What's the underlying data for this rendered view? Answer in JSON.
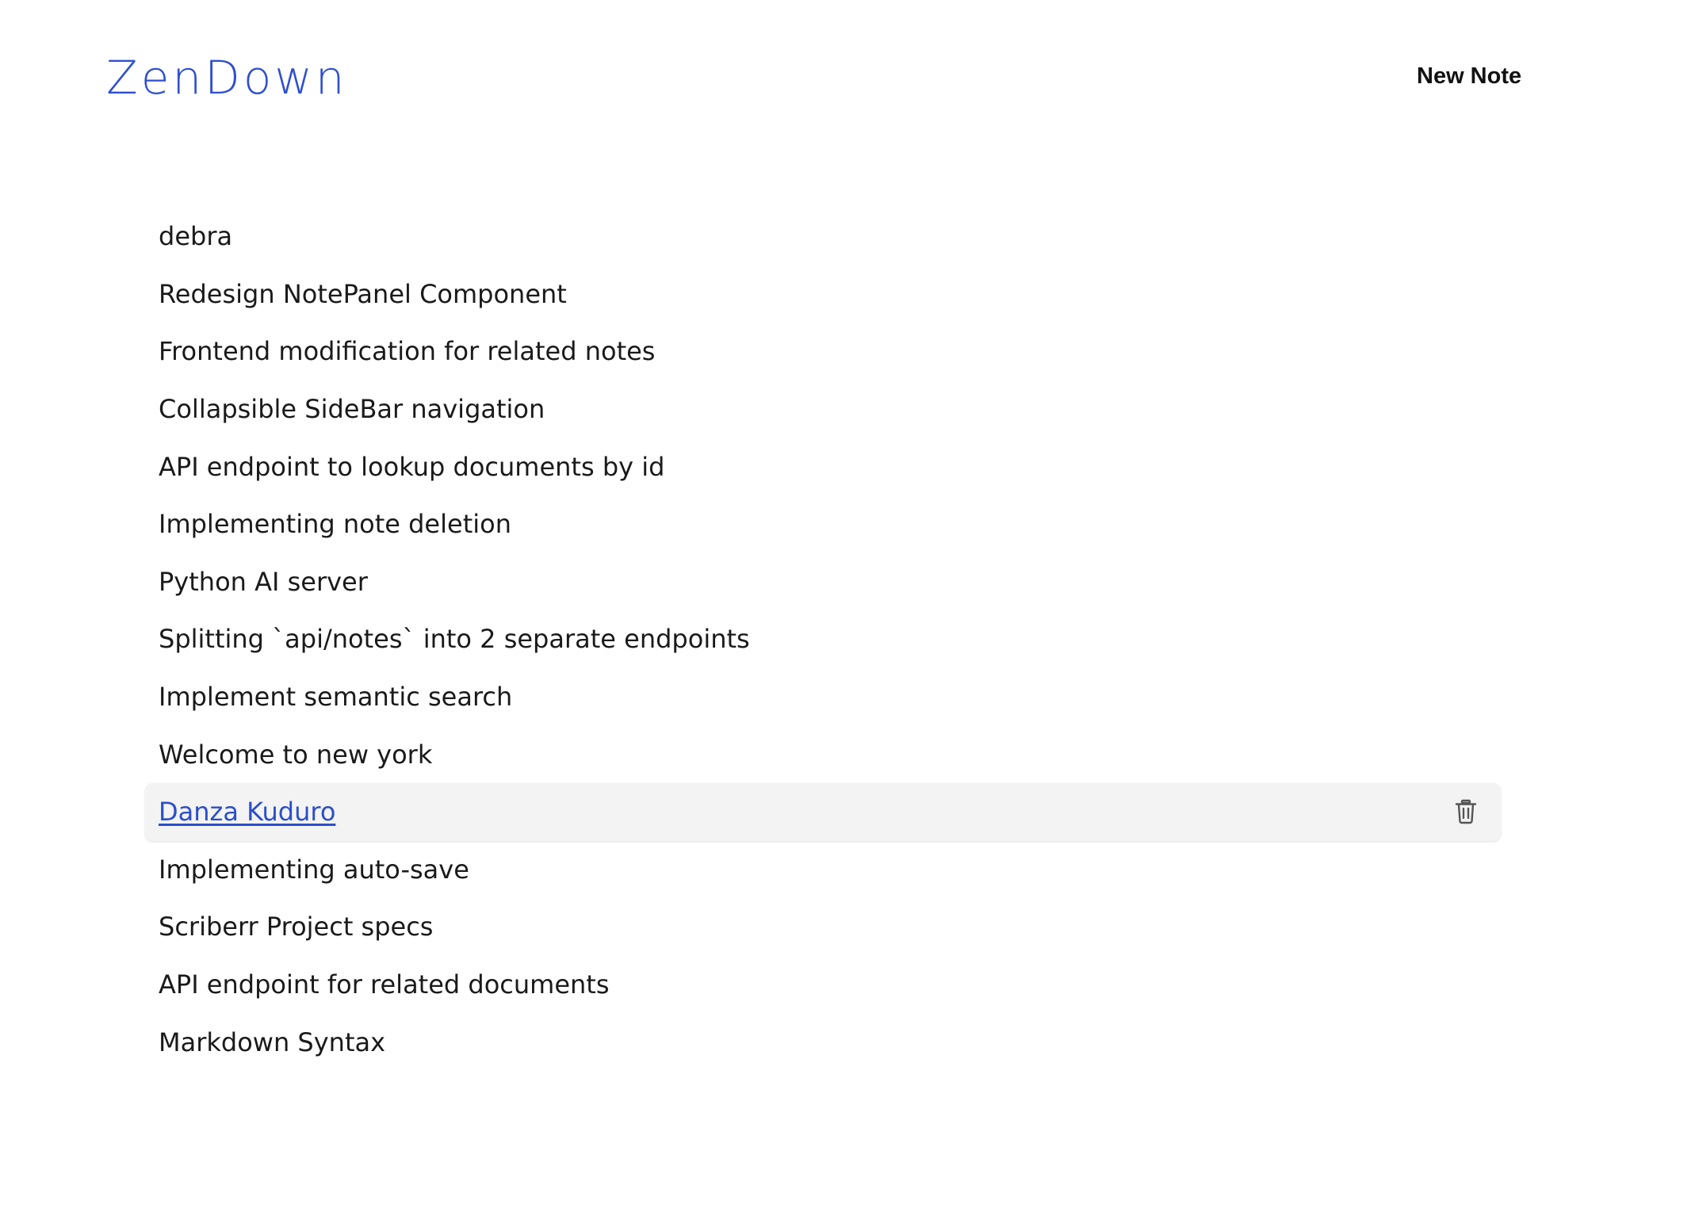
{
  "app": {
    "logo_text": "ZenDown",
    "brand_color": "#2f4fd0"
  },
  "header": {
    "new_note_label": "New Note"
  },
  "notes": [
    {
      "title": "debra"
    },
    {
      "title": "Redesign NotePanel Component"
    },
    {
      "title": "Frontend modification for related notes"
    },
    {
      "title": "Collapsible SideBar navigation"
    },
    {
      "title": "API endpoint to lookup documents by id"
    },
    {
      "title": "Implementing note deletion"
    },
    {
      "title": "Python AI server"
    },
    {
      "title": "Splitting `api/notes` into 2 separate endpoints"
    },
    {
      "title": "Implement semantic search"
    },
    {
      "title": "Welcome to new york"
    },
    {
      "title": "Danza Kuduro",
      "hovered": true,
      "action_icon": "trash-icon"
    },
    {
      "title": "Implementing auto-save"
    },
    {
      "title": "Scriberr Project specs"
    },
    {
      "title": "API endpoint for related documents"
    },
    {
      "title": "Markdown Syntax"
    }
  ]
}
